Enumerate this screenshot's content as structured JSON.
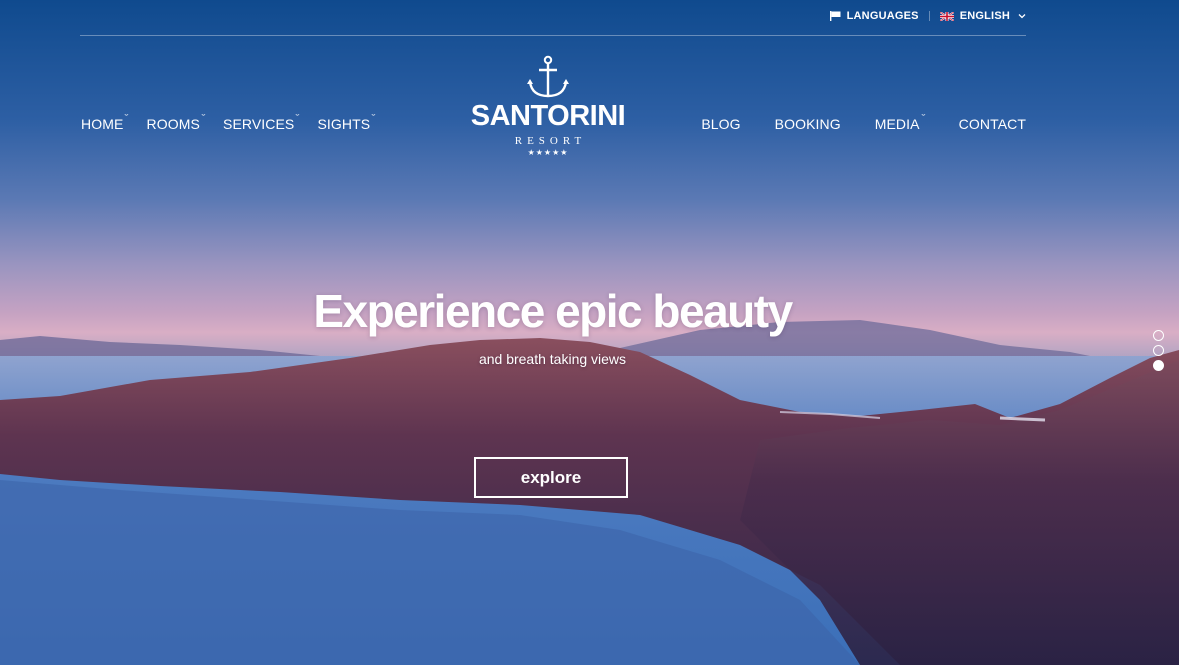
{
  "topbar": {
    "languages_label": "LANGUAGES",
    "language_selected": "ENGLISH"
  },
  "nav": {
    "left": [
      {
        "label": "HOME",
        "has_dropdown": true
      },
      {
        "label": "ROOMS",
        "has_dropdown": true
      },
      {
        "label": "SERVICES",
        "has_dropdown": true
      },
      {
        "label": "SIGHTS",
        "has_dropdown": true
      }
    ],
    "right": [
      {
        "label": "BLOG",
        "has_dropdown": false
      },
      {
        "label": "BOOKING",
        "has_dropdown": false
      },
      {
        "label": "MEDIA",
        "has_dropdown": true
      },
      {
        "label": "CONTACT",
        "has_dropdown": false
      }
    ],
    "caret": "ˇ"
  },
  "logo": {
    "name": "SANTORINI",
    "subtitle": "RESORT",
    "stars": "★★★★★",
    "icon": "anchor-icon"
  },
  "hero": {
    "headline": "Experience epic beauty",
    "subline": "and breath taking views",
    "cta_label": "explore"
  },
  "slider": {
    "slide_count": 3,
    "active_index": 2
  },
  "colors": {
    "sky_top": "#0f4a8e",
    "sky_glow": "#d9aec5",
    "sea": "#5b7db6",
    "cliff": "#4a2f4e",
    "text": "#ffffff"
  }
}
